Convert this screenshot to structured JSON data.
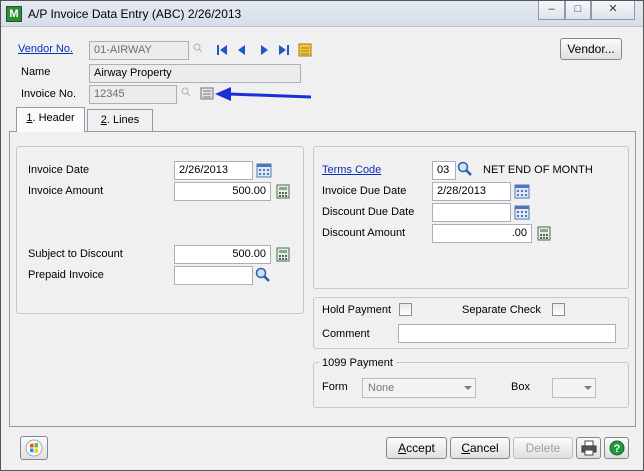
{
  "window": {
    "title": "A/P Invoice Data Entry (ABC) 2/26/2013",
    "controls": [
      "minimize",
      "maximize",
      "close"
    ]
  },
  "header": {
    "vendor_no_label": "Vendor No.",
    "vendor_no_value": "01-AIRWAY",
    "name_label": "Name",
    "name_value": "Airway Property",
    "invoice_no_label": "Invoice No.",
    "invoice_no_value": "12345",
    "vendor_button": "Vendor..."
  },
  "tabs": [
    {
      "num": "1",
      "label": ". Header"
    },
    {
      "num": "2",
      "label": ". Lines"
    }
  ],
  "left_panel": {
    "invoice_date_label": "Invoice Date",
    "invoice_date_value": "2/26/2013",
    "invoice_amount_label": "Invoice Amount",
    "invoice_amount_value": "500.00",
    "subject_to_discount_label": "Subject to Discount",
    "subject_to_discount_value": "500.00",
    "prepaid_invoice_label": "Prepaid Invoice",
    "prepaid_invoice_value": ""
  },
  "right_panel": {
    "terms_code_label": "Terms Code",
    "terms_code_value": "03",
    "terms_desc": "NET END OF MONTH",
    "invoice_due_date_label": "Invoice Due Date",
    "invoice_due_date_value": "2/28/2013",
    "discount_due_date_label": "Discount Due Date",
    "discount_due_date_value": "",
    "discount_amount_label": "Discount Amount",
    "discount_amount_value": ".00"
  },
  "payment_options": {
    "hold_payment_label": "Hold Payment",
    "separate_check_label": "Separate Check",
    "comment_label": "Comment",
    "comment_value": ""
  },
  "form_1099": {
    "title": "1099 Payment",
    "form_label": "Form",
    "form_value": "None",
    "box_label": "Box",
    "box_value": ""
  },
  "footer": {
    "accept_label": "ccept",
    "accept_underline": "A",
    "cancel_label": "ancel",
    "cancel_underline": "C",
    "delete_label": "Delete"
  },
  "colors": {
    "link": "#0b2fb8",
    "annotation_arrow": "#1a2fd6"
  }
}
